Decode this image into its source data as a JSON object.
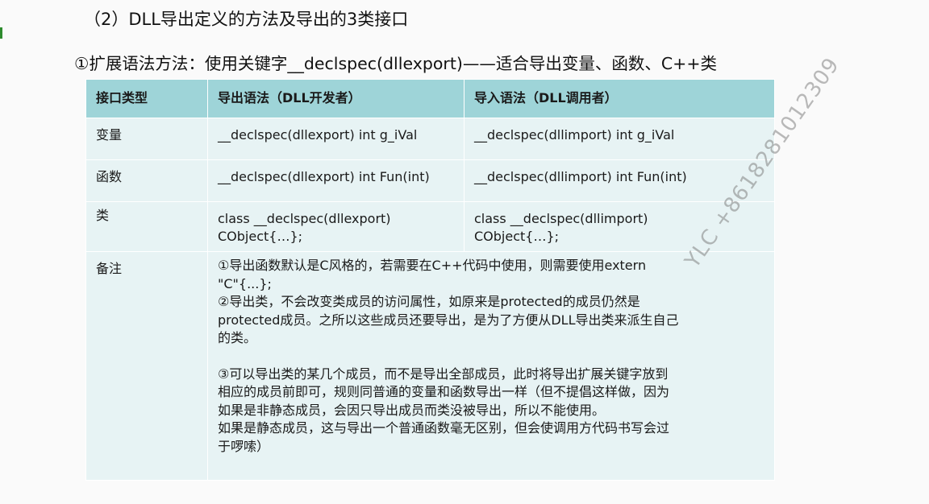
{
  "heading": "（2）DLL导出定义的方法及导出的3类接口",
  "subheading": "①扩展语法方法：使用关键字__declspec(dllexport)——适合导出变量、函数、C++类",
  "table": {
    "headers": [
      "接口类型",
      "导出语法（DLL开发者）",
      "导入语法（DLL调用者）"
    ],
    "rows": [
      {
        "type": "变量",
        "export": [
          "__declspec(dllexport) int g_iVal"
        ],
        "import": [
          "__declspec(dllimport) int g_iVal"
        ]
      },
      {
        "type": "函数",
        "export": [
          "__declspec(dllexport) int Fun(int)"
        ],
        "import": [
          "__declspec(dllimport) int Fun(int)"
        ]
      },
      {
        "type": "类",
        "export": [
          "class __declspec(dllexport)",
          "CObject{…};"
        ],
        "import": [
          "class __declspec(dllimport)",
          "CObject{…};"
        ]
      }
    ],
    "notes_label": "备注",
    "notes": [
      "①导出函数默认是C风格的，若需要在C++代码中使用，则需要使用extern",
      "\"C\"{...};",
      "②导出类，不会改变类成员的访问属性，如原来是protected的成员仍然是",
      "protected成员。之所以这些成员还要导出，是为了方便从DLL导出类来派生自己",
      "的类。",
      "③可以导出类的某几个成员，而不是导出全部成员，此时将导出扩展关键字放到",
      "相应的成员前即可，规则同普通的变量和函数导出一样（但不提倡这样做，因为",
      "如果是非静态成员，会因只导出成员而类没被导出，所以不能使用。",
      "如果是静态成员，这与导出一个普通函数毫无区别，但会使调用方代码书写会过",
      "于啰嗦）"
    ]
  },
  "watermark": "YLC +8618281012309"
}
